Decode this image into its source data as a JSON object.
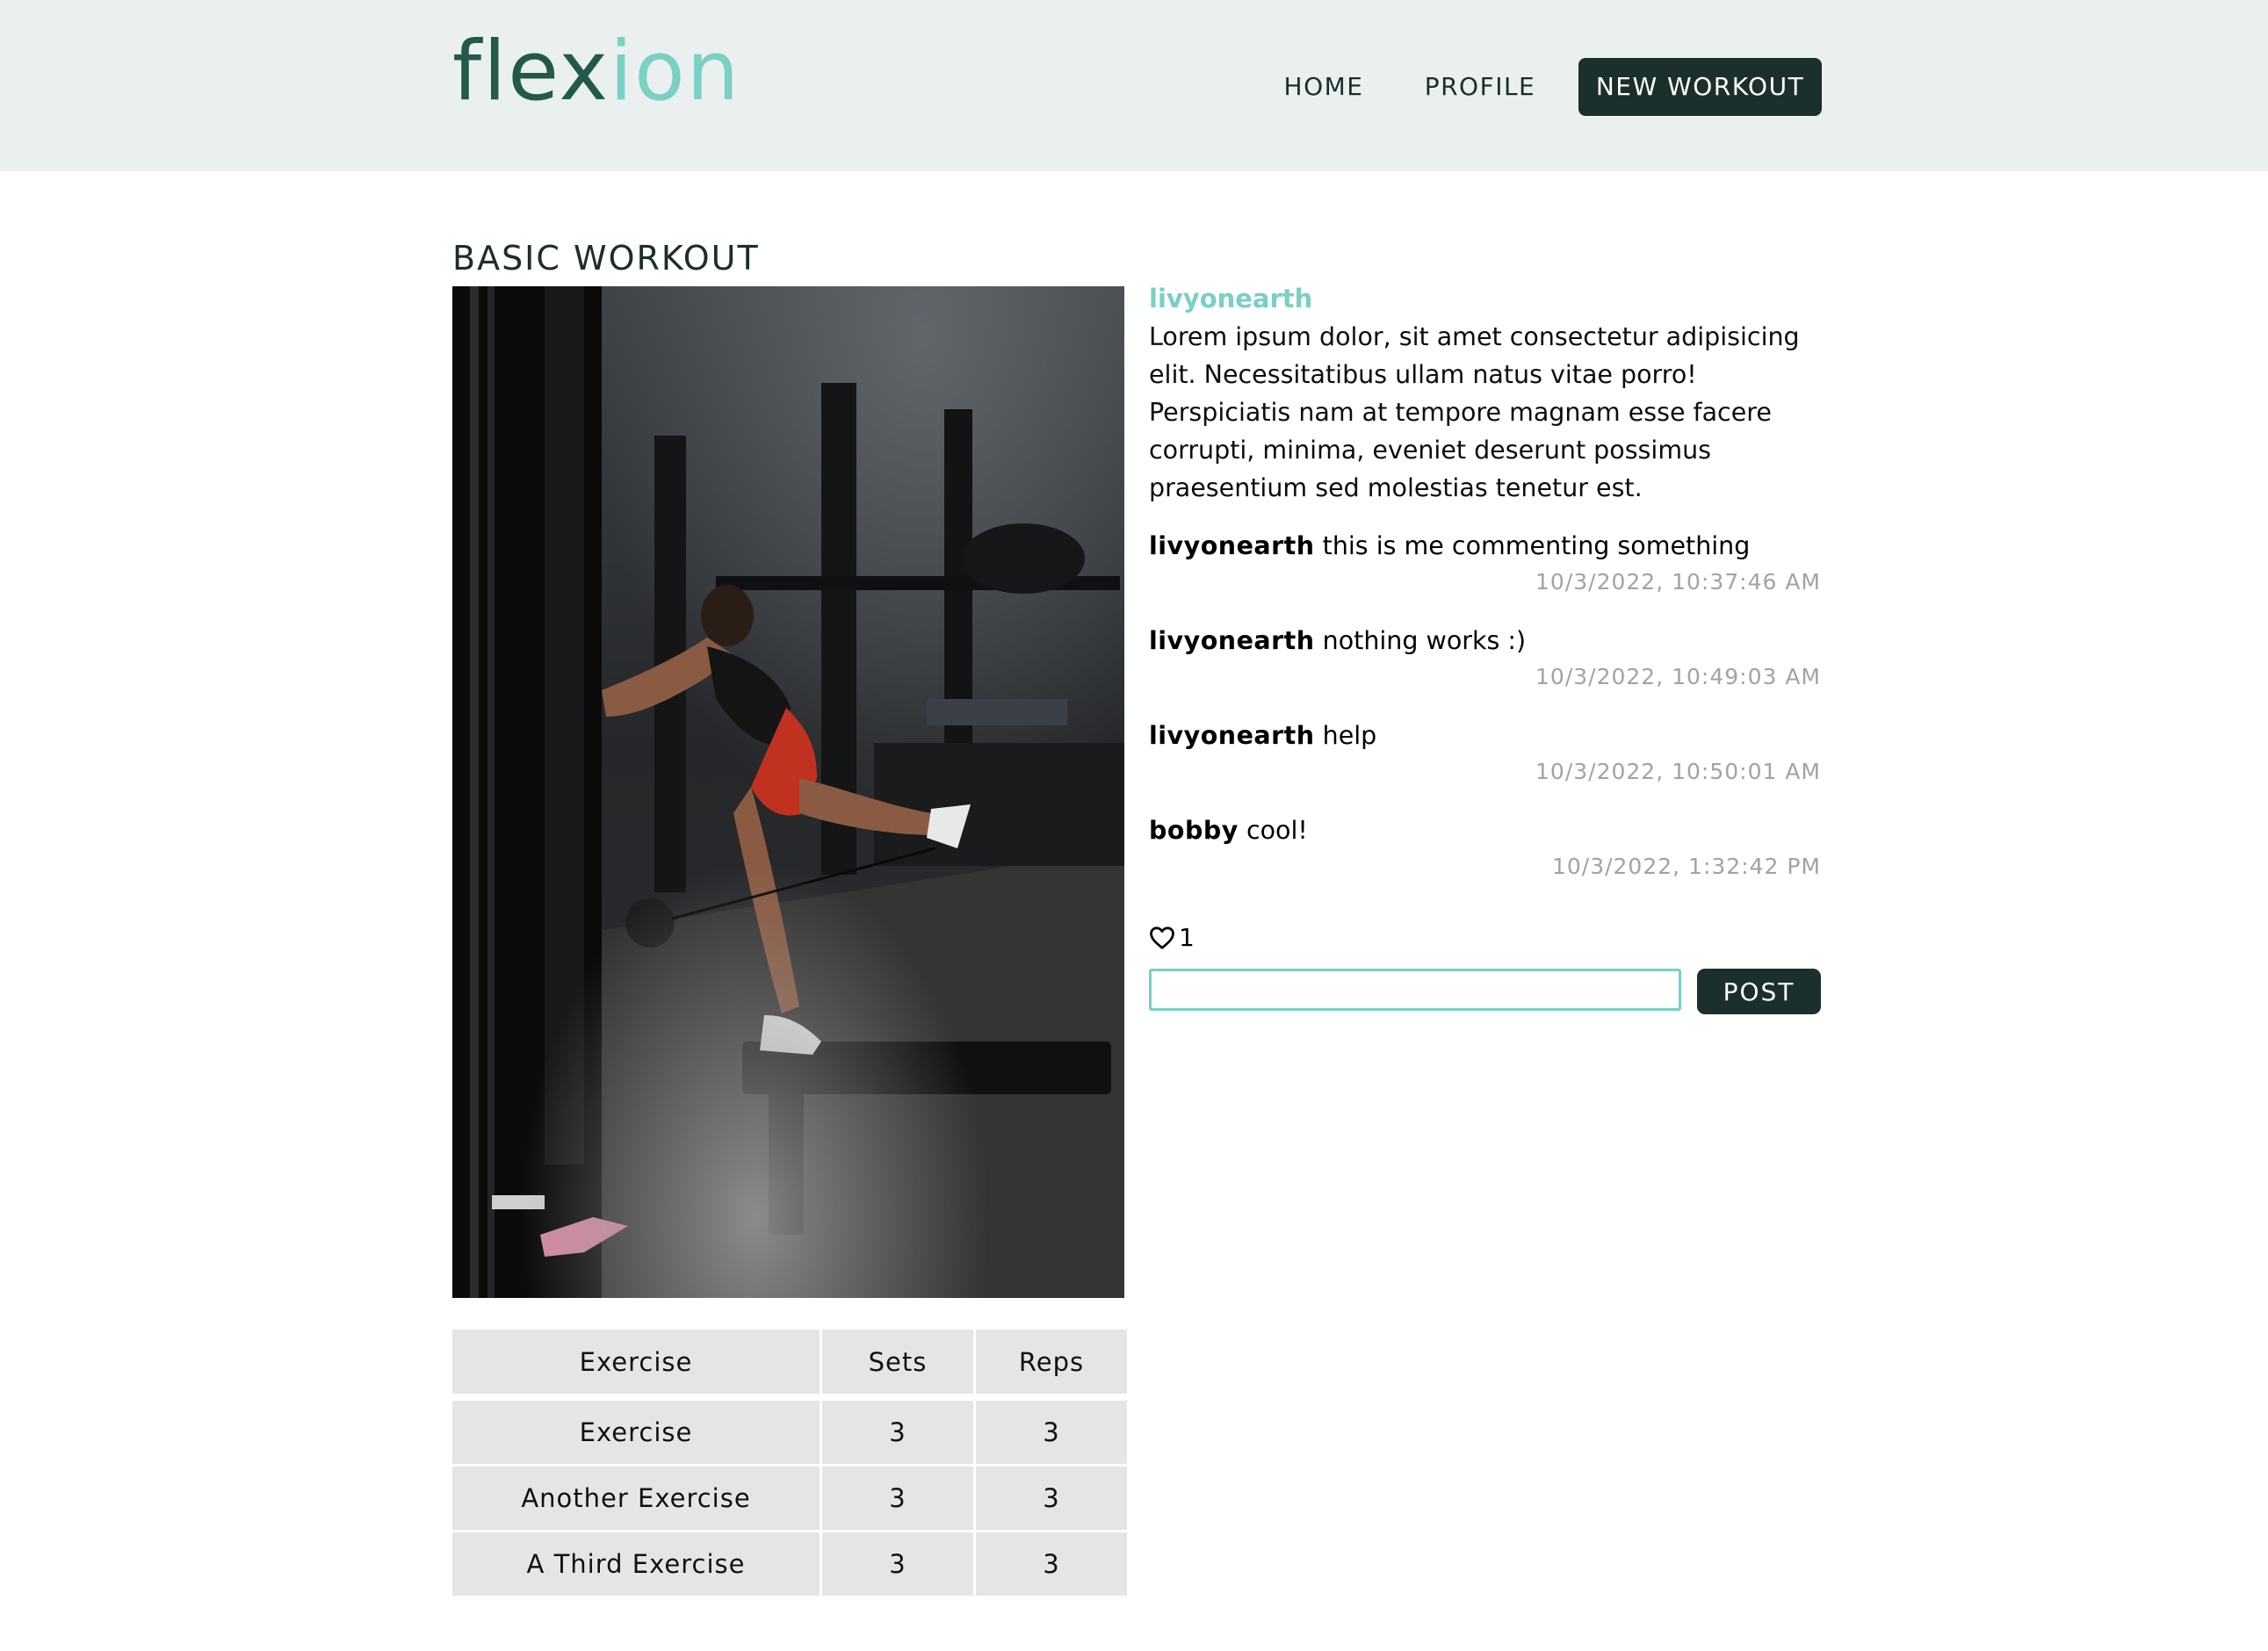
{
  "brand": {
    "part1": "flex",
    "part2": "ion",
    "color_dark": "#23594a",
    "color_light": "#79d0c3"
  },
  "nav": {
    "home": "HOME",
    "profile": "PROFILE",
    "new_workout": "NEW WORKOUT"
  },
  "workout": {
    "title": "BASIC WORKOUT",
    "author": "livyonearth",
    "description": "Lorem ipsum dolor, sit amet consectetur adipisicing elit. Necessitatibus ullam natus vitae porro! Perspiciatis nam at tempore magnam esse facere corrupti, minima, eveniet deserunt possimus praesentium sed molestias tenetur est.",
    "photo_icon": "gym-photo"
  },
  "table": {
    "headers": [
      "Exercise",
      "Sets",
      "Reps"
    ],
    "rows": [
      [
        "Exercise",
        "3",
        "3"
      ],
      [
        "Another Exercise",
        "3",
        "3"
      ],
      [
        "A Third Exercise",
        "3",
        "3"
      ]
    ]
  },
  "comments": [
    {
      "user": "livyonearth",
      "text": "this is me commenting something",
      "time": "10/3/2022, 10:37:46 AM"
    },
    {
      "user": "livyonearth",
      "text": "nothing works :)",
      "time": "10/3/2022, 10:49:03 AM"
    },
    {
      "user": "livyonearth",
      "text": "help",
      "time": "10/3/2022, 10:50:01 AM"
    },
    {
      "user": "bobby",
      "text": "cool!",
      "time": "10/3/2022, 1:32:42 PM"
    }
  ],
  "likes": {
    "count": "1",
    "icon": "heart-icon"
  },
  "comment_form": {
    "value": "",
    "post_label": "POST"
  }
}
